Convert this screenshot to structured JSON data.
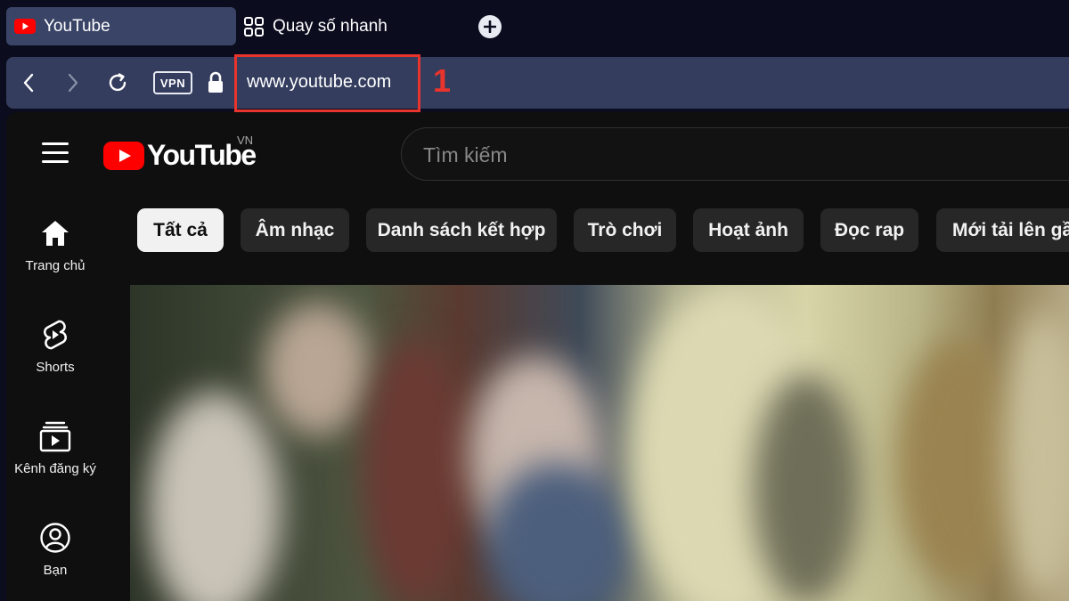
{
  "browser": {
    "tabs": [
      {
        "title": "YouTube",
        "active": true,
        "icon": "youtube-icon"
      },
      {
        "title": "Quay số nhanh",
        "active": false,
        "icon": "grid-icon"
      }
    ],
    "new_tab_icon": "plus-icon",
    "nav": {
      "back_icon": "chevron-left-icon",
      "forward_icon": "chevron-right-icon",
      "reload_icon": "reload-icon"
    },
    "vpn_label": "VPN",
    "lock_icon": "lock-icon",
    "url": "www.youtube.com",
    "annotation_number": "1"
  },
  "youtube": {
    "logo_text": "YouTube",
    "country_code": "VN",
    "search_placeholder": "Tìm kiếm",
    "sidebar": [
      {
        "label": "Trang chủ",
        "icon": "home-icon"
      },
      {
        "label": "Shorts",
        "icon": "shorts-icon"
      },
      {
        "label": "Kênh đăng ký",
        "icon": "subscriptions-icon"
      },
      {
        "label": "Bạn",
        "icon": "account-icon"
      }
    ],
    "chips": [
      {
        "label": "Tất cả",
        "active": true
      },
      {
        "label": "Âm nhạc",
        "active": false
      },
      {
        "label": "Danh sách kết hợp",
        "active": false
      },
      {
        "label": "Trò chơi",
        "active": false
      },
      {
        "label": "Hoạt ảnh",
        "active": false
      },
      {
        "label": "Đọc rap",
        "active": false
      },
      {
        "label": "Mới tải lên gầ",
        "active": false
      }
    ]
  },
  "colors": {
    "brand_red": "#ff0000",
    "annotation_red": "#e8342c",
    "tabstrip_bg": "#0b0d1f",
    "addressbar_bg": "#343d5e"
  }
}
